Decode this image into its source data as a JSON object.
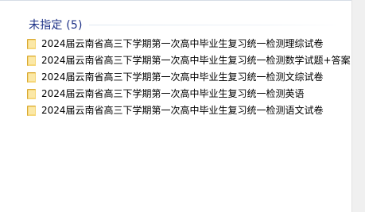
{
  "group": {
    "title": "未指定",
    "count": "(5)"
  },
  "items": [
    {
      "label": "2024届云南省高三下学期第一次高中毕业生复习统一检测理综试卷"
    },
    {
      "label": "2024届云南省高三下学期第一次高中毕业生复习统一检测数学试题+答案"
    },
    {
      "label": "2024届云南省高三下学期第一次高中毕业生复习统一检测文综试卷"
    },
    {
      "label": "2024届云南省高三下学期第一次高中毕业生复习统一检测英语"
    },
    {
      "label": "2024届云南省高三下学期第一次高中毕业生复习统一检测语文试卷"
    }
  ],
  "colors": {
    "group_title": "#1e3287",
    "folder_light": "#f6d77a",
    "folder_dark": "#d9a933"
  }
}
